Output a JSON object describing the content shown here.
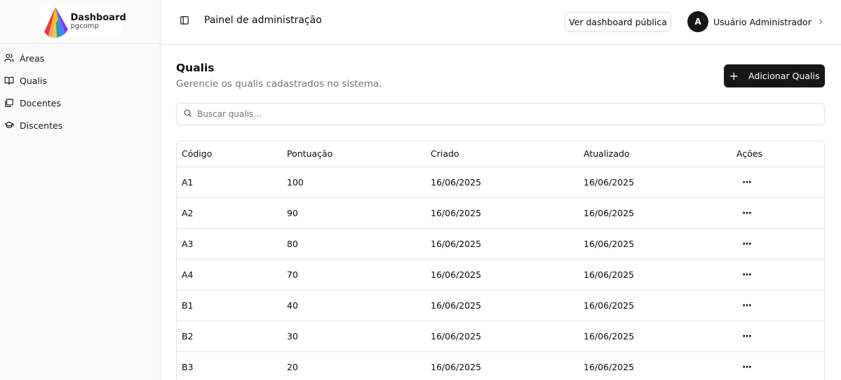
{
  "logo": {
    "title": "Dashboard",
    "subtitle": "pgcomp"
  },
  "sidebar": {
    "items": [
      {
        "label": "Áreas",
        "icon": "users-icon"
      },
      {
        "label": "Qualis",
        "icon": "book-open-icon"
      },
      {
        "label": "Docentes",
        "icon": "library-icon"
      },
      {
        "label": "Discentes",
        "icon": "graduation-cap-icon"
      }
    ]
  },
  "header": {
    "title": "Painel de administração",
    "public_button": "Ver dashboard pública",
    "user": {
      "initial": "A",
      "name": "Usuário Administrador"
    }
  },
  "main": {
    "title": "Qualis",
    "subtitle": "Gerencie os qualis cadastrados no sistema.",
    "add_button": "Adicionar Qualis",
    "search_placeholder": "Buscar qualis..."
  },
  "table": {
    "columns": [
      "Código",
      "Pontuação",
      "Criado",
      "Atualizado",
      "Ações"
    ],
    "rows": [
      {
        "codigo": "A1",
        "pontuacao": "100",
        "criado": "16/06/2025",
        "atualizado": "16/06/2025"
      },
      {
        "codigo": "A2",
        "pontuacao": "90",
        "criado": "16/06/2025",
        "atualizado": "16/06/2025"
      },
      {
        "codigo": "A3",
        "pontuacao": "80",
        "criado": "16/06/2025",
        "atualizado": "16/06/2025"
      },
      {
        "codigo": "A4",
        "pontuacao": "70",
        "criado": "16/06/2025",
        "atualizado": "16/06/2025"
      },
      {
        "codigo": "B1",
        "pontuacao": "40",
        "criado": "16/06/2025",
        "atualizado": "16/06/2025"
      },
      {
        "codigo": "B2",
        "pontuacao": "30",
        "criado": "16/06/2025",
        "atualizado": "16/06/2025"
      },
      {
        "codigo": "B3",
        "pontuacao": "20",
        "criado": "16/06/2025",
        "atualizado": "16/06/2025"
      }
    ],
    "actions_glyph": "···"
  },
  "colors": {
    "primary": "#171717",
    "muted_text": "#737373",
    "border": "#e5e5e5",
    "sidebar_bg": "#fafafa"
  }
}
